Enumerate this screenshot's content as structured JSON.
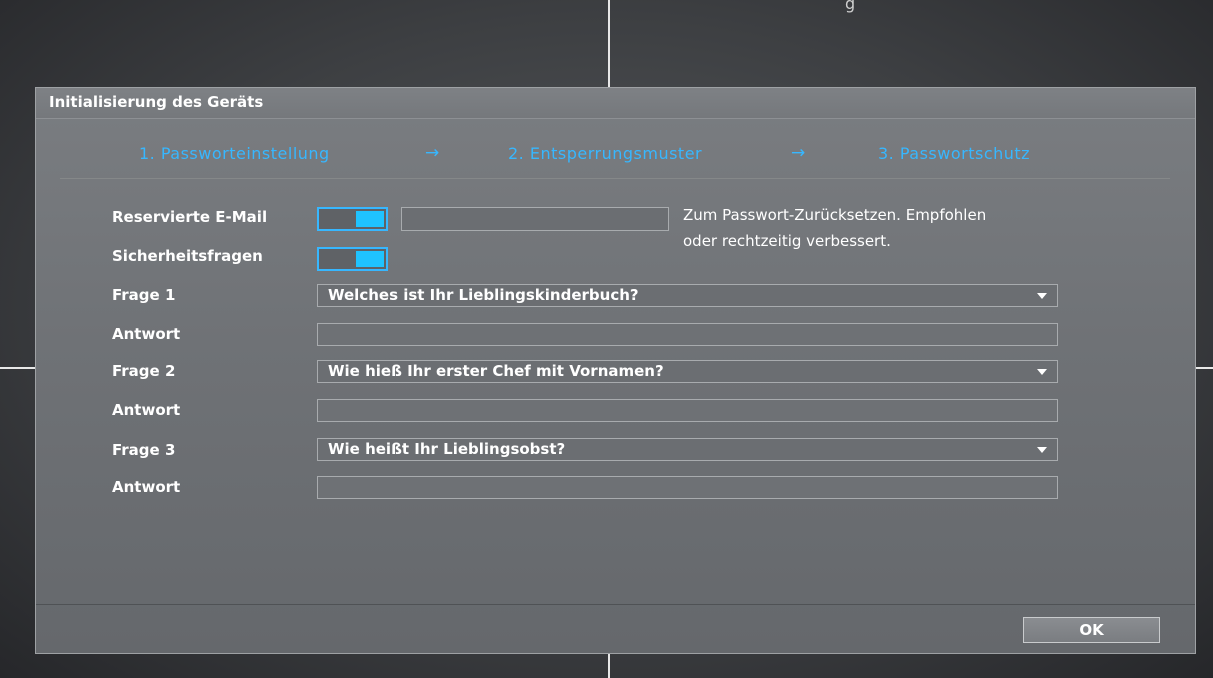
{
  "background": {
    "top_text": "g"
  },
  "dialog": {
    "title": "Initialisierung des Geräts",
    "steps": [
      {
        "label": "1.  Passworteinstellung"
      },
      {
        "label": "2.  Entsperrungsmuster"
      },
      {
        "label": "3.  Passwortschutz"
      }
    ],
    "step_arrow": "→",
    "email": {
      "label": "Reservierte E-Mail",
      "toggle_on": true,
      "value": "",
      "hint_line1": "Zum Passwort-Zurücksetzen. Empfohlen",
      "hint_line2": "oder rechtzeitig verbessert."
    },
    "security_questions": {
      "label": "Sicherheitsfragen",
      "toggle_on": true
    },
    "questions": [
      {
        "label": "Frage 1",
        "value": "Welches ist Ihr Lieblingskinderbuch?",
        "answer_label": "Antwort",
        "answer": ""
      },
      {
        "label": "Frage 2",
        "value": "Wie hieß Ihr erster Chef mit Vornamen?",
        "answer_label": "Antwort",
        "answer": ""
      },
      {
        "label": "Frage 3",
        "value": "Wie heißt Ihr Lieblingsobst?",
        "answer_label": "Antwort",
        "answer": ""
      }
    ],
    "ok_label": "OK"
  },
  "colors": {
    "accent": "#37b7ff",
    "toggle_knob": "#1fc3ff",
    "dialog_bg": "#6f7276",
    "text": "#ffffff"
  },
  "icons": {
    "cursor": "mouse-pointer-icon",
    "dropdown": "triangle-down-icon"
  }
}
